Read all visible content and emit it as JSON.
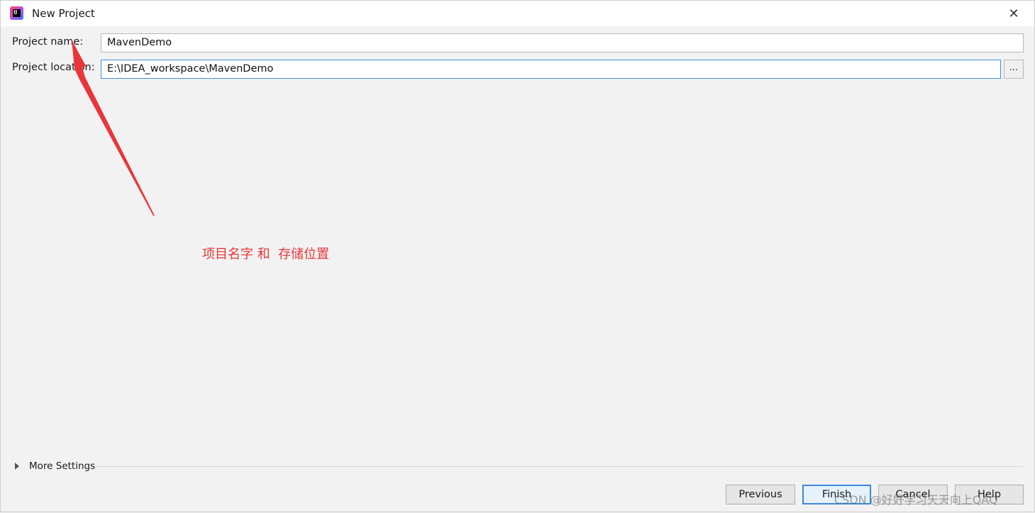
{
  "window": {
    "title": "New Project",
    "close_symbol": "✕",
    "app_icon_letters": "IJ"
  },
  "form": {
    "project_name_label": "Project name:",
    "project_name_value": "MavenDemo",
    "project_location_label": "Project location:",
    "project_location_value": "E:\\IDEA_workspace\\MavenDemo",
    "browse_label": "..."
  },
  "annotation": {
    "text": "项目名字 和  存储位置",
    "color": "#e8363a"
  },
  "more_settings": {
    "label": "More Settings"
  },
  "buttons": {
    "previous": "Previous",
    "finish": "Finish",
    "cancel": "Cancel",
    "help": "Help"
  },
  "watermark": "CSDN @好好学习天天向上QAQ",
  "colors": {
    "focus_border": "#3f8fd8",
    "annotation_red": "#e8363a"
  }
}
